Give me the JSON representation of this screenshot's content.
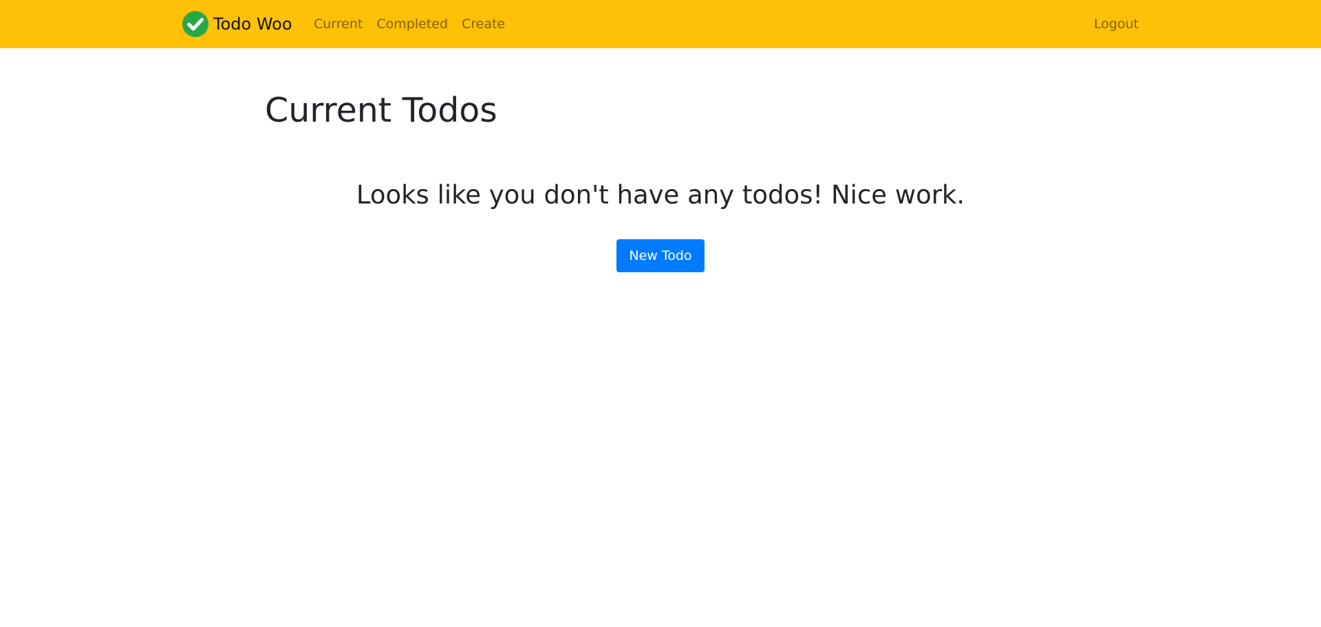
{
  "navbar": {
    "brand": "Todo Woo",
    "links": [
      {
        "label": "Current"
      },
      {
        "label": "Completed"
      },
      {
        "label": "Create"
      }
    ],
    "logout_label": "Logout",
    "background_color": "#ffc107",
    "logo_icon": "green-check-circle-icon"
  },
  "main": {
    "title": "Current Todos",
    "empty_message": "Looks like you don't have any todos! Nice work.",
    "new_todo_label": "New Todo",
    "button_color": "#007bff"
  }
}
